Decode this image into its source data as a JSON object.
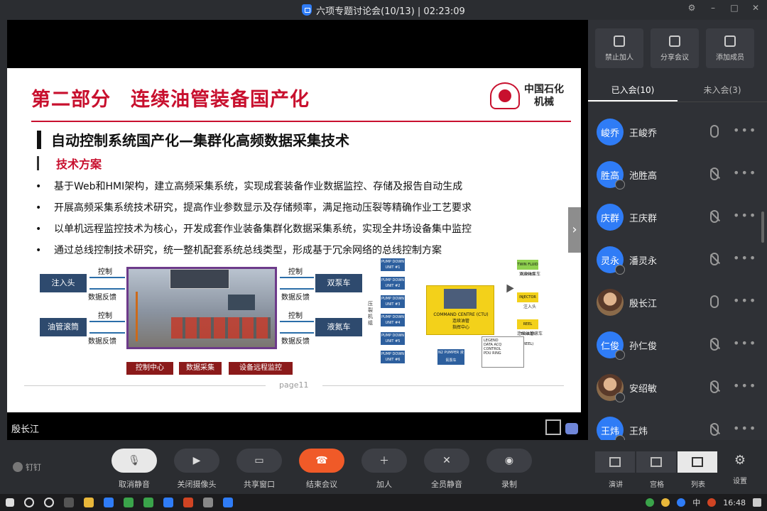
{
  "window": {
    "title": "六项专题讨论会(10/13) | 02:23:09",
    "controls": [
      "⚙",
      "–",
      "□",
      "✕"
    ]
  },
  "slide": {
    "title": "第二部分　连续油管装备国产化",
    "logo_text_line1": "中国石化",
    "logo_text_line2": "机械",
    "heading": "自动控制系统国产化—集群化高频数据采集技术",
    "subheading": "技术方案",
    "bullets": [
      "基于Web和HMI架构，建立高频采集系统，实现成套装备作业数据监控、存储及报告自动生成",
      "开展高频采集系统技术研究，提高作业参数显示及存储频率，满足拖动压裂等精确作业工艺要求",
      "以单机远程监控技术为核心，开发成套作业装备集群化数据采集系统，实现全井场设备集中监控",
      "通过总线控制技术研究，统一整机配套系统总线类型，形成基于冗余网络的总线控制方案"
    ],
    "left_diagram": {
      "left_boxes": [
        "注入头",
        "油管滚筒"
      ],
      "right_boxes": [
        "双泵车",
        "液氮车"
      ],
      "control_label": "控制",
      "feedback_label": "数据反馈",
      "bottom_boxes": [
        "控制中心",
        "数据采集",
        "设备远程监控"
      ]
    },
    "right_diagram": {
      "pumps": [
        "PUMP DOWN UNIT #1",
        "PUMP DOWN UNIT #2",
        "PUMP DOWN UNIT #3",
        "PUMP DOWN UNIT #4",
        "PUMP DOWN UNIT #5",
        "PUMP DOWN UNIT #6"
      ],
      "side_label": "压裂机组",
      "center_en": "COMMAND CENTRE (CTU)",
      "center_cn1": "连续油管",
      "center_cn2": "指挥中心",
      "right_boxes": [
        {
          "en": "TWIN FLUID PUMPER",
          "cn": "双流体泵车",
          "color": "#8fd14f"
        },
        {
          "en": "INJECTOR",
          "cn": "注入头",
          "color": "#f3d11a"
        },
        {
          "en": "REEL TRAILER (REEL)",
          "cn": "连续油管滚车",
          "color": "#f3d11a"
        }
      ],
      "n2": "N2 PUMPER 液氮泵车",
      "legend_title": "LEGEND",
      "legend_items": [
        "DATA ACQ",
        "CONTROL",
        "PDU RING"
      ]
    },
    "page_num": "page11"
  },
  "stage": {
    "speaker_name": "殷长江"
  },
  "panel": {
    "tools": [
      {
        "icon": "lock-icon",
        "label": "禁止加人"
      },
      {
        "icon": "share-icon",
        "label": "分享会议"
      },
      {
        "icon": "add-member-icon",
        "label": "添加成员"
      }
    ],
    "tabs": [
      "已入会(10)",
      "未入会(3)"
    ],
    "members": [
      {
        "avatar": "峻乔",
        "name": "王峻乔",
        "muted": false,
        "photo": false,
        "badge": false
      },
      {
        "avatar": "胜高",
        "name": "池胜高",
        "muted": true,
        "photo": false,
        "badge": true
      },
      {
        "avatar": "庆群",
        "name": "王庆群",
        "muted": true,
        "photo": false,
        "badge": false
      },
      {
        "avatar": "灵永",
        "name": "潘灵永",
        "muted": true,
        "photo": false,
        "badge": true
      },
      {
        "avatar": "",
        "name": "殷长江",
        "muted": false,
        "photo": true,
        "badge": false
      },
      {
        "avatar": "仁俊",
        "name": "孙仁俊",
        "muted": true,
        "photo": false,
        "badge": true
      },
      {
        "avatar": "",
        "name": "安绍敏",
        "muted": true,
        "photo": true,
        "badge": true
      },
      {
        "avatar": "王炜",
        "name": "王炜",
        "muted": true,
        "photo": false,
        "badge": true
      }
    ]
  },
  "toolbar": {
    "brand": "钉钉",
    "controls": [
      "取消静音",
      "关闭摄像头",
      "共享窗口",
      "结束会议",
      "加人",
      "全员静音",
      "录制"
    ],
    "views": [
      "演讲",
      "宫格",
      "列表"
    ],
    "settings": "设置"
  },
  "taskbar": {
    "time": "16:48",
    "ime": "中"
  }
}
